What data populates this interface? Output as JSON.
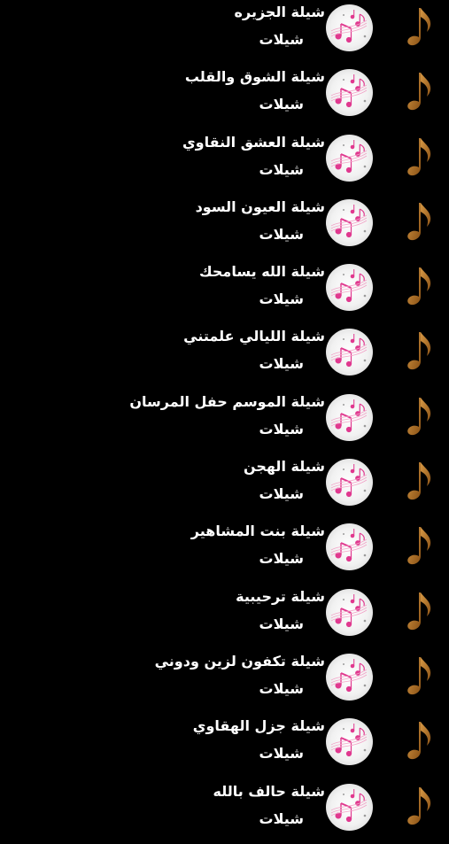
{
  "items": [
    {
      "title": "شيلة الجزيره",
      "subtitle": "شيلات",
      "icon": "music-note-icon",
      "thumb": "pink-music-notes-thumbnail"
    },
    {
      "title": "شيلة الشوق والقلب",
      "subtitle": "شيلات",
      "icon": "music-note-icon",
      "thumb": "pink-music-notes-thumbnail"
    },
    {
      "title": "شيلة العشق النقاوي",
      "subtitle": "شيلات",
      "icon": "music-note-icon",
      "thumb": "pink-music-notes-thumbnail"
    },
    {
      "title": "شيلة العيون السود",
      "subtitle": "شيلات",
      "icon": "music-note-icon",
      "thumb": "pink-music-notes-thumbnail"
    },
    {
      "title": "شيلة الله يسامحك",
      "subtitle": "شيلات",
      "icon": "music-note-icon",
      "thumb": "pink-music-notes-thumbnail"
    },
    {
      "title": "شيلة الليالي علمتني",
      "subtitle": "شيلات",
      "icon": "music-note-icon",
      "thumb": "pink-music-notes-thumbnail"
    },
    {
      "title": "شيلة الموسم حفل المرسان",
      "subtitle": "شيلات",
      "icon": "music-note-icon",
      "thumb": "pink-music-notes-thumbnail"
    },
    {
      "title": "شيلة الهجن",
      "subtitle": "شيلات",
      "icon": "music-note-icon",
      "thumb": "pink-music-notes-thumbnail"
    },
    {
      "title": "شيلة بنت المشاهير",
      "subtitle": "شيلات",
      "icon": "music-note-icon",
      "thumb": "pink-music-notes-thumbnail"
    },
    {
      "title": "شيلة ترحيبية",
      "subtitle": "شيلات",
      "icon": "music-note-icon",
      "thumb": "pink-music-notes-thumbnail"
    },
    {
      "title": "شيلة تكفون لزين ودوني",
      "subtitle": "شيلات",
      "icon": "music-note-icon",
      "thumb": "pink-music-notes-thumbnail"
    },
    {
      "title": "شيلة جزل الهقاوي",
      "subtitle": "شيلات",
      "icon": "music-note-icon",
      "thumb": "pink-music-notes-thumbnail"
    },
    {
      "title": "شيلة حالف بالله",
      "subtitle": "شيلات",
      "icon": "music-note-icon",
      "thumb": "pink-music-notes-thumbnail"
    }
  ],
  "colors": {
    "background": "#000000",
    "text": "#ffffff",
    "note_icon": "#b7782a",
    "thumb_notes": "#e0398f"
  }
}
